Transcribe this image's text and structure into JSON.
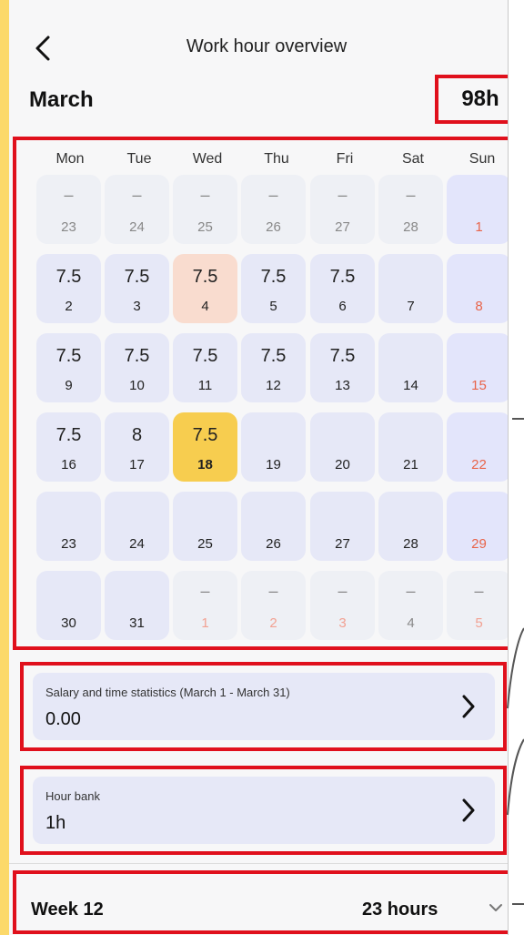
{
  "header": {
    "title": "Work hour overview"
  },
  "month": {
    "name": "March",
    "total": "98h"
  },
  "calendar": {
    "weekdays": [
      "Mon",
      "Tue",
      "Wed",
      "Thu",
      "Fri",
      "Sat",
      "Sun"
    ],
    "weeks": [
      [
        {
          "h": "–",
          "d": "23"
        },
        {
          "h": "–",
          "d": "24"
        },
        {
          "h": "–",
          "d": "25"
        },
        {
          "h": "–",
          "d": "26"
        },
        {
          "h": "–",
          "d": "27"
        },
        {
          "h": "–",
          "d": "28"
        },
        {
          "h": "",
          "d": "1"
        }
      ],
      [
        {
          "h": "7.5",
          "d": "2"
        },
        {
          "h": "7.5",
          "d": "3"
        },
        {
          "h": "7.5",
          "d": "4"
        },
        {
          "h": "7.5",
          "d": "5"
        },
        {
          "h": "7.5",
          "d": "6"
        },
        {
          "h": "",
          "d": "7"
        },
        {
          "h": "",
          "d": "8"
        }
      ],
      [
        {
          "h": "7.5",
          "d": "9"
        },
        {
          "h": "7.5",
          "d": "10"
        },
        {
          "h": "7.5",
          "d": "11"
        },
        {
          "h": "7.5",
          "d": "12"
        },
        {
          "h": "7.5",
          "d": "13"
        },
        {
          "h": "",
          "d": "14"
        },
        {
          "h": "",
          "d": "15"
        }
      ],
      [
        {
          "h": "7.5",
          "d": "16"
        },
        {
          "h": "8",
          "d": "17"
        },
        {
          "h": "7.5",
          "d": "18"
        },
        {
          "h": "",
          "d": "19"
        },
        {
          "h": "",
          "d": "20"
        },
        {
          "h": "",
          "d": "21"
        },
        {
          "h": "",
          "d": "22"
        }
      ],
      [
        {
          "h": "",
          "d": "23"
        },
        {
          "h": "",
          "d": "24"
        },
        {
          "h": "",
          "d": "25"
        },
        {
          "h": "",
          "d": "26"
        },
        {
          "h": "",
          "d": "27"
        },
        {
          "h": "",
          "d": "28"
        },
        {
          "h": "",
          "d": "29"
        }
      ],
      [
        {
          "h": "",
          "d": "30"
        },
        {
          "h": "",
          "d": "31"
        },
        {
          "h": "–",
          "d": "1"
        },
        {
          "h": "–",
          "d": "2"
        },
        {
          "h": "–",
          "d": "3"
        },
        {
          "h": "–",
          "d": "4"
        },
        {
          "h": "–",
          "d": "5"
        }
      ]
    ]
  },
  "salary": {
    "label": "Salary and time statistics (March 1 - March 31)",
    "value": "0.00"
  },
  "hour_bank": {
    "label": "Hour bank",
    "value": "1h"
  },
  "week": {
    "label": "Week 12",
    "hours": "23 hours"
  },
  "colors": {
    "accent_today": "#f7cd4f",
    "highlight_peach": "#f9dccf",
    "cell_bg": "#e6e8f7",
    "weekend_red": "#e8644a",
    "annotation_red": "#e0101c",
    "frame_yellow": "#fcd96a"
  },
  "icons": {
    "back": "chevron-left-icon",
    "card_arrow": "chevron-right-icon",
    "week_toggle": "chevron-down-icon"
  }
}
